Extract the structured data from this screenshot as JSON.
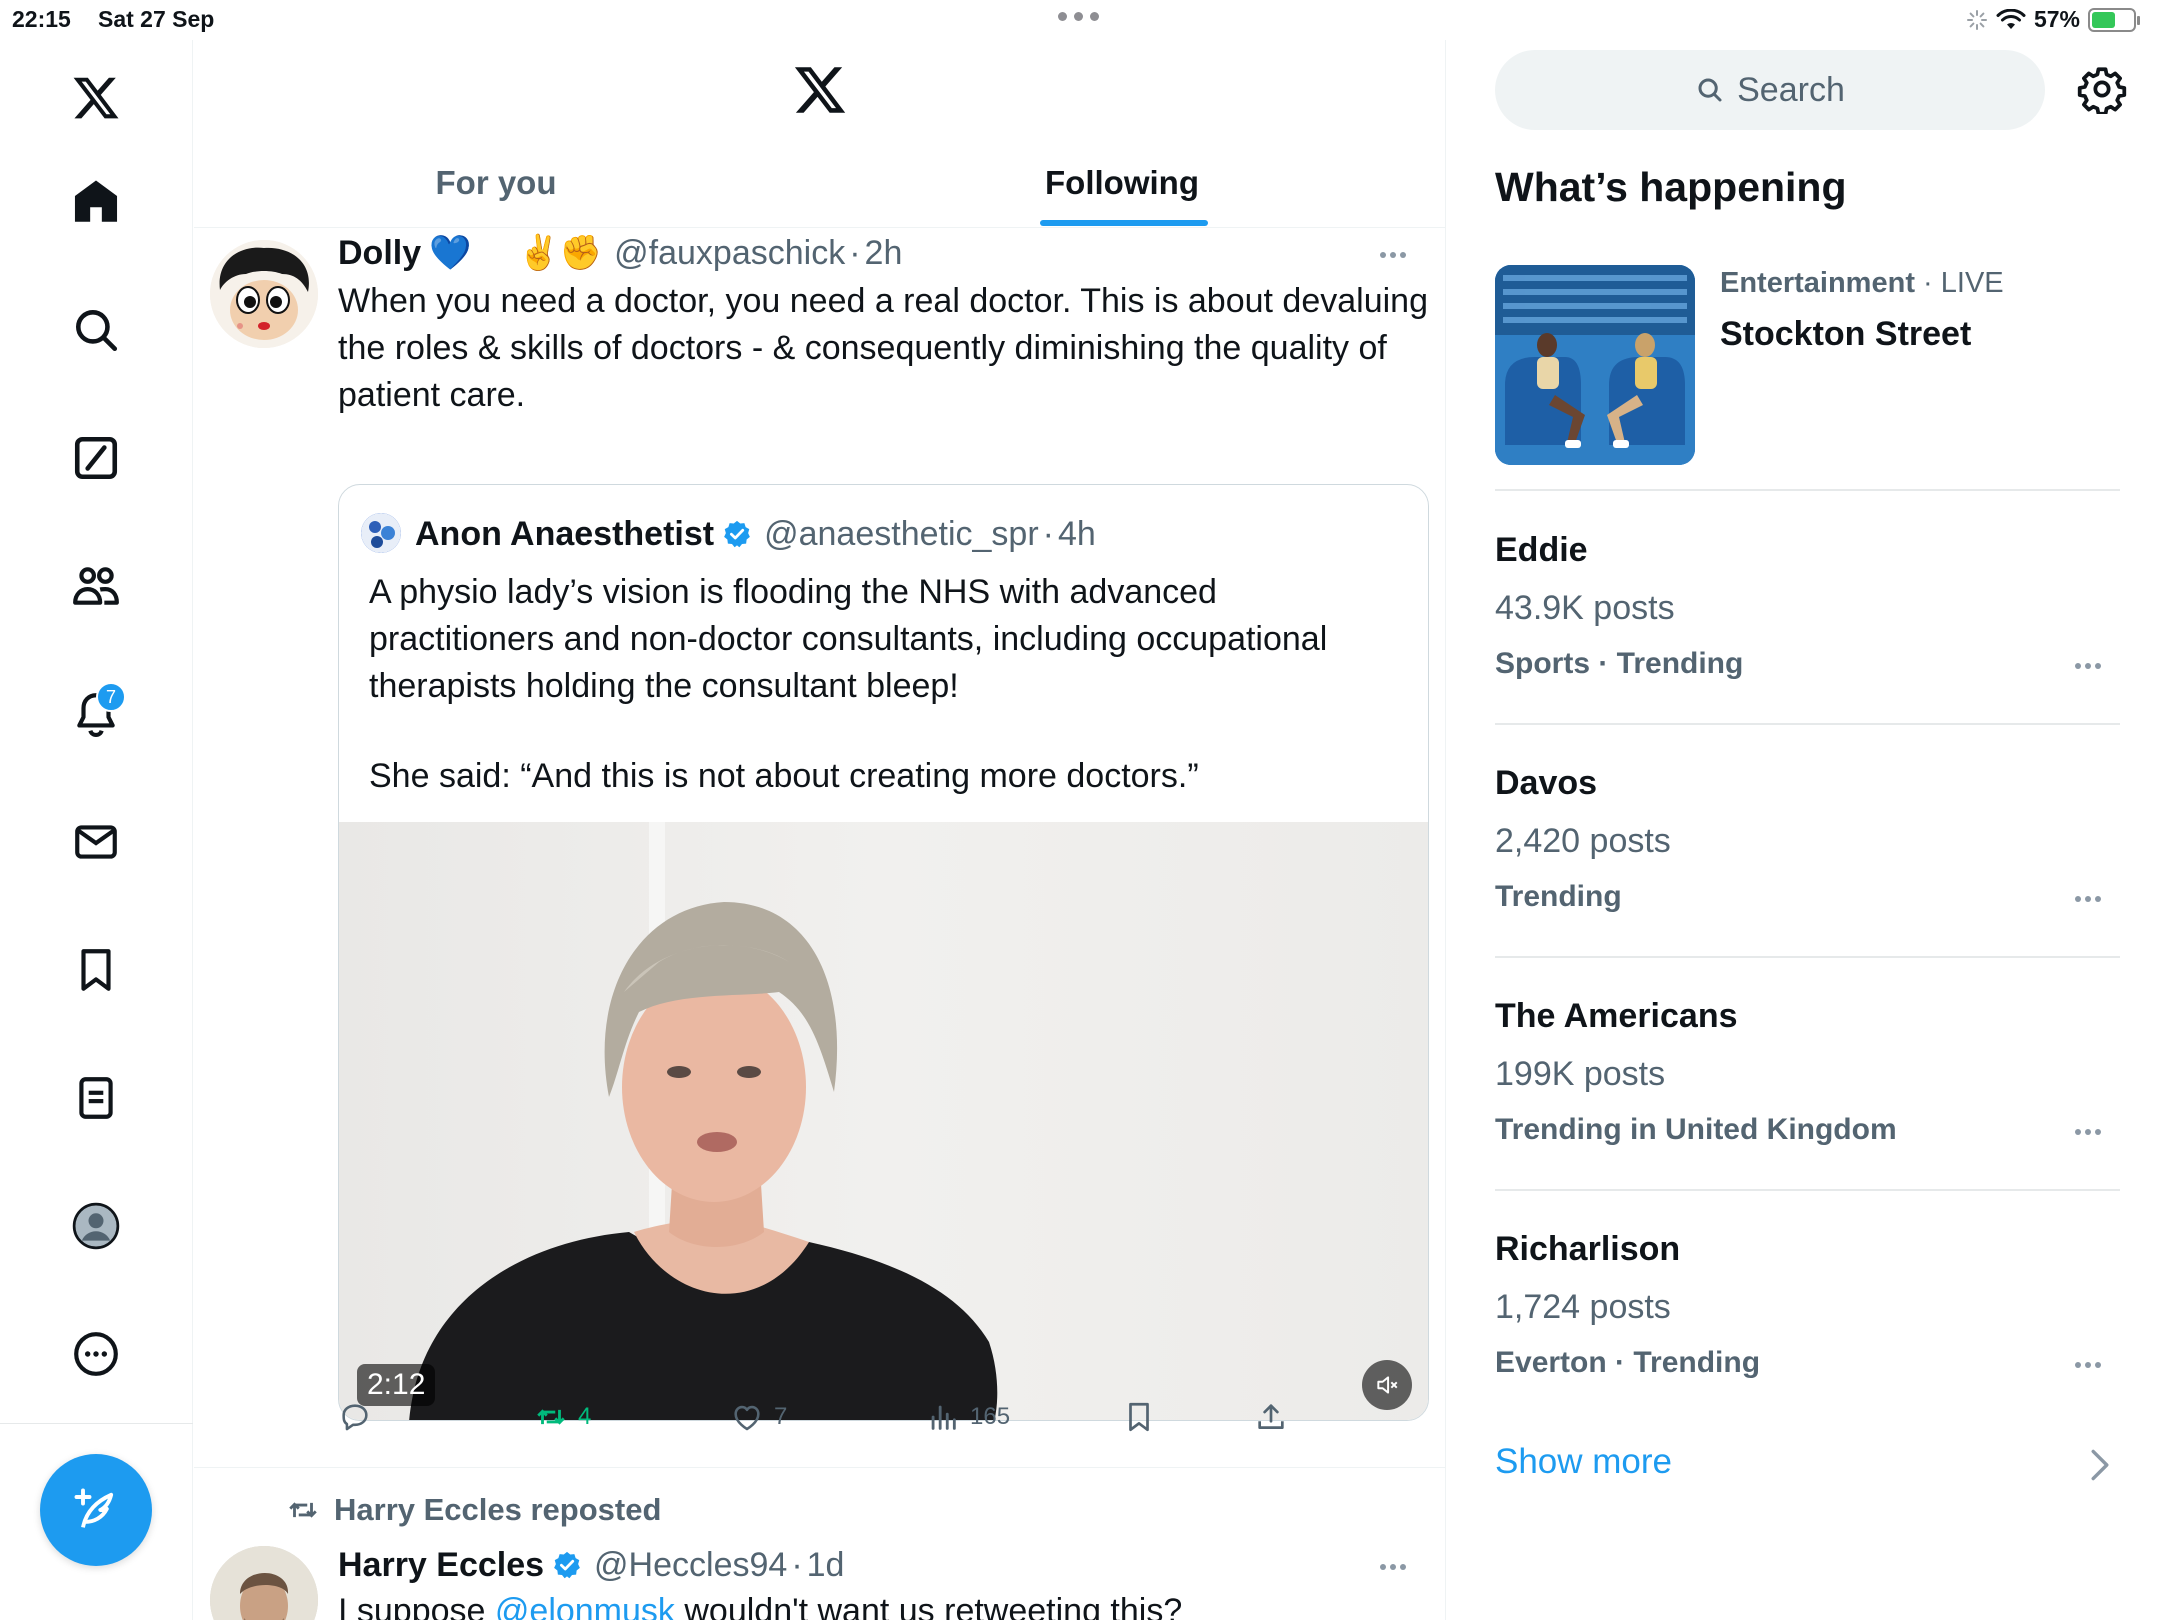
{
  "status": {
    "time": "22:15",
    "date": "Sat 27 Sep",
    "battery": "57%",
    "battery_level": 0.57
  },
  "nav": {
    "notifications_badge": "7"
  },
  "tabs": {
    "for_you": "For you",
    "following": "Following"
  },
  "posts": [
    {
      "name": "Dolly",
      "emoji": "💙",
      "emoji2": "✌️✊",
      "handle": "@fauxpaschick",
      "sep": "·",
      "time": "2h",
      "text": "When you need a doctor, you need a real doctor. This is about devaluing the roles & skills of doctors - & consequently diminishing the quality of patient care.",
      "quote": {
        "name": "Anon Anaesthetist",
        "handle": "@anaesthetic_spr",
        "sep": "·",
        "time": "4h",
        "text1": "A physio lady’s vision is flooding the NHS with advanced practitioners and non-doctor consultants, including occupational therapists holding the consultant bleep!",
        "text2": "She said: “And this is not about creating more doctors.”",
        "video_duration": "2:12"
      },
      "stats": {
        "retweets": "4",
        "likes": "7",
        "views": "165"
      }
    },
    {
      "repost_label": "Harry Eccles reposted",
      "name": "Harry Eccles",
      "handle": "@Heccles94",
      "sep": "·",
      "time": "1d",
      "text_prefix": "I suppose ",
      "mention": "@elonmusk",
      "text_suffix": " wouldn't want us retweeting this?"
    }
  ],
  "sidebar": {
    "search_placeholder": "Search",
    "heading": "What’s happening",
    "featured": {
      "category": "Entertainment",
      "sep": " · ",
      "live": "LIVE",
      "headline": "Stockton Street"
    },
    "trends": [
      {
        "title": "Eddie",
        "count": "43.9K posts",
        "category": "Sports · Trending"
      },
      {
        "title": "Davos",
        "count": "2,420 posts",
        "category": "Trending"
      },
      {
        "title": "The Americans",
        "count": "199K posts",
        "category": "Trending in United Kingdom"
      },
      {
        "title": "Richarlison",
        "count": "1,724 posts",
        "category": "Everton · Trending"
      }
    ],
    "show_more": "Show more"
  },
  "colors": {
    "accent": "#1d9bf0",
    "secondary_text": "#536471",
    "retweet_green": "#00ba7c"
  }
}
